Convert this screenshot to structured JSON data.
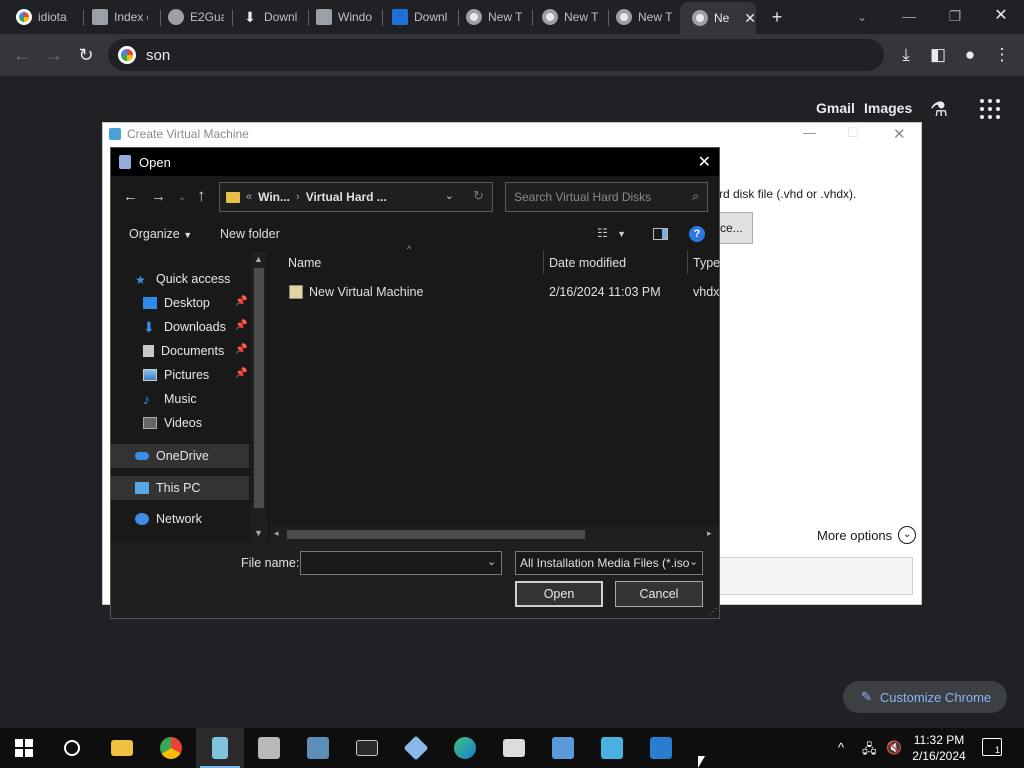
{
  "browser": {
    "tabs": [
      {
        "label": "idiota",
        "favicon": "google-icon"
      },
      {
        "label": "Index o",
        "favicon": "index-icon"
      },
      {
        "label": "E2Gua",
        "favicon": "globe-icon"
      },
      {
        "label": "Downl",
        "favicon": "download-icon"
      },
      {
        "label": "Windo",
        "favicon": "library-icon"
      },
      {
        "label": "Downl",
        "favicon": "windows-icon"
      },
      {
        "label": "New T",
        "favicon": "chrome-icon"
      },
      {
        "label": "New T",
        "favicon": "chrome-icon"
      },
      {
        "label": "New T",
        "favicon": "chrome-icon"
      },
      {
        "label": "Ne",
        "favicon": "chrome-icon",
        "active": true
      }
    ],
    "omnibox_text": "son",
    "ntp_links": {
      "gmail": "Gmail",
      "images": "Images"
    },
    "customize_label": "Customize Chrome"
  },
  "create_vm": {
    "title": "Create Virtual Machine",
    "hint_text": "rd disk file (.vhd or .vhdx).",
    "browse_label": "ce...",
    "more_options": "More options"
  },
  "open_dialog": {
    "title": "Open",
    "breadcrumb": {
      "prefix": "«",
      "part1": "Win...",
      "part2": "Virtual Hard ..."
    },
    "search_placeholder": "Search Virtual Hard Disks",
    "organize_label": "Organize",
    "new_folder_label": "New folder",
    "nav_items": {
      "quick_access": "Quick access",
      "desktop": "Desktop",
      "downloads": "Downloads",
      "documents": "Documents",
      "pictures": "Pictures",
      "music": "Music",
      "videos": "Videos",
      "onedrive": "OneDrive",
      "this_pc": "This PC",
      "network": "Network"
    },
    "columns": {
      "name": "Name",
      "date": "Date modified",
      "type": "Type"
    },
    "files": [
      {
        "name": "New Virtual Machine",
        "date": "2/16/2024 11:03 PM",
        "type": "vhdx"
      }
    ],
    "file_name_label": "File name:",
    "file_name_value": "",
    "filter_value": "All Installation Media Files (*.iso",
    "open_label": "Open",
    "cancel_label": "Cancel"
  },
  "taskbar": {
    "time": "11:32 PM",
    "date": "2/16/2024",
    "notification_count": "1"
  }
}
